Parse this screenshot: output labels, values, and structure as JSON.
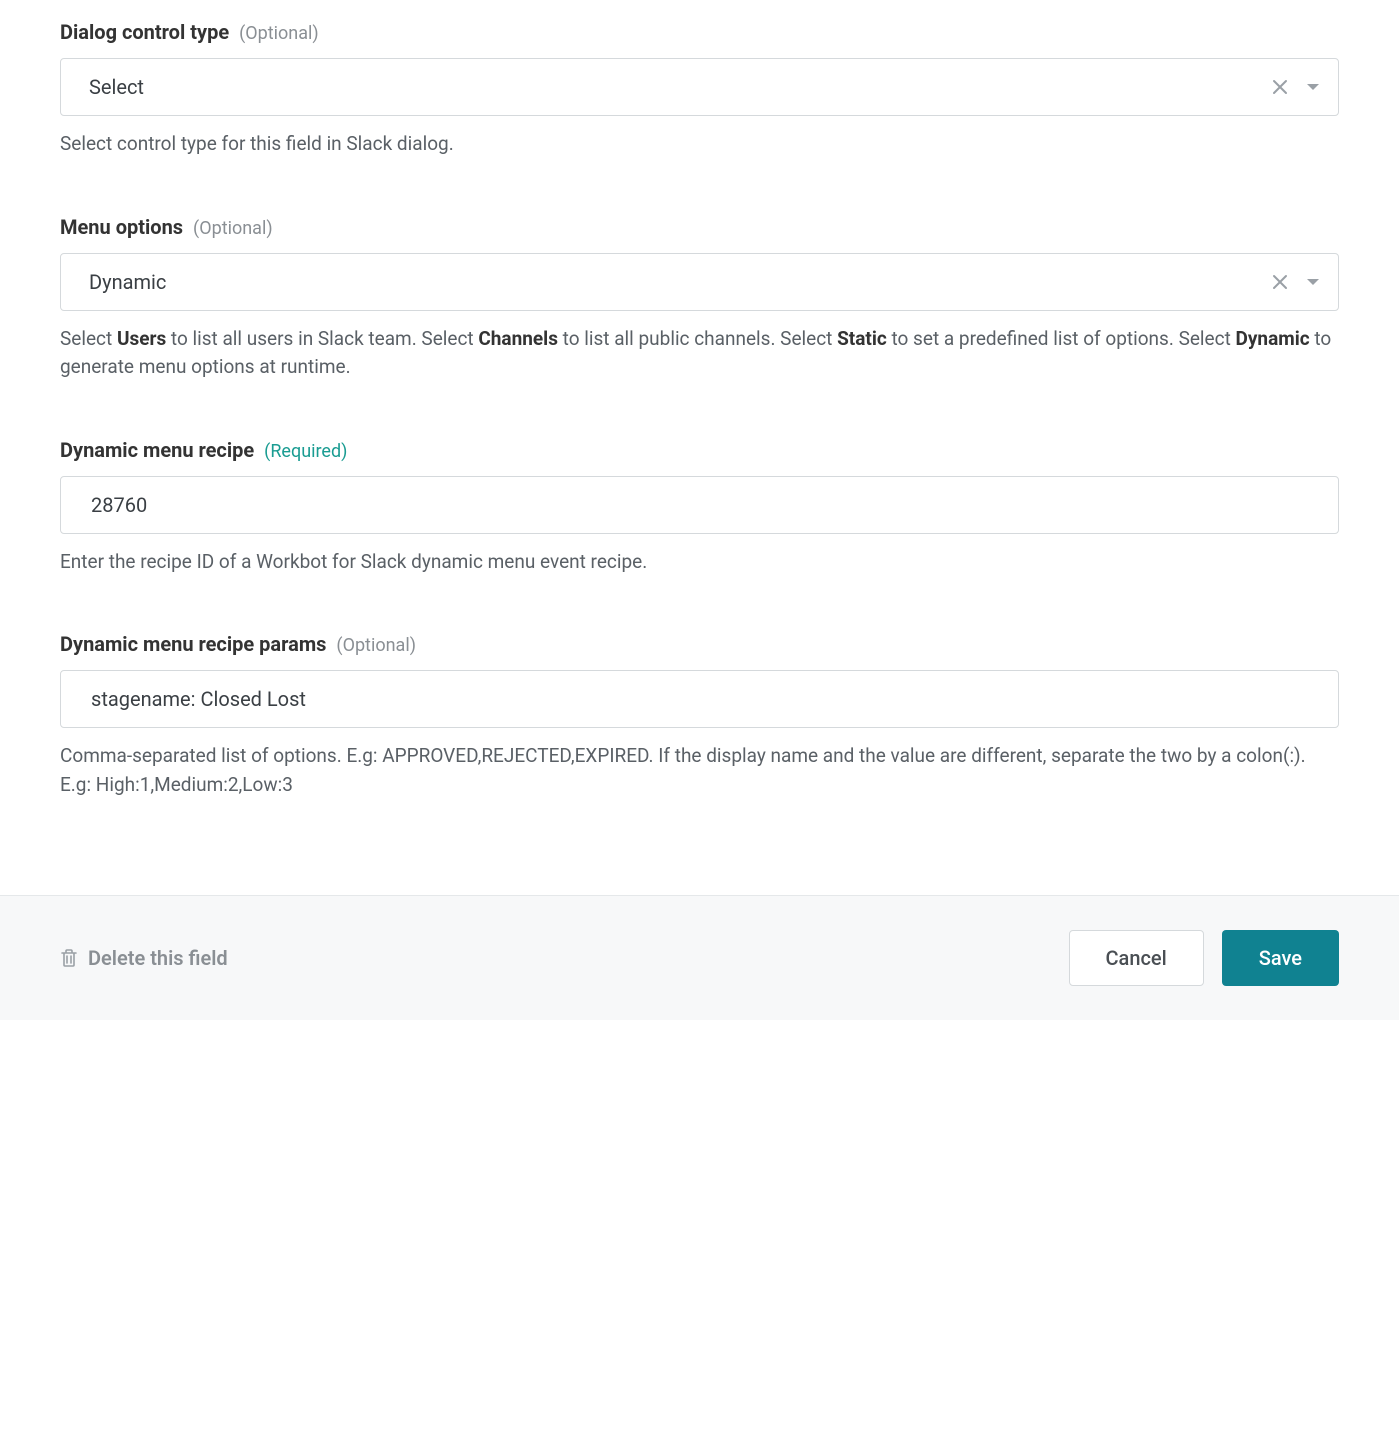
{
  "fields": {
    "dialog_control_type": {
      "label": "Dialog control type",
      "annotation": "(Optional)",
      "value": "Select",
      "hint": "Select control type for this field in Slack dialog."
    },
    "menu_options": {
      "label": "Menu options",
      "annotation": "(Optional)",
      "value": "Dynamic",
      "hint_parts": [
        "Select ",
        "Users",
        " to list all users in Slack team. Select ",
        "Channels",
        " to list all public channels. Select ",
        "Static",
        " to set a predefined list of options. Select ",
        "Dynamic",
        " to generate menu options at runtime."
      ]
    },
    "dynamic_menu_recipe": {
      "label": "Dynamic menu recipe",
      "annotation": "(Required)",
      "value": "28760",
      "hint": "Enter the recipe ID of a Workbot for Slack dynamic menu event recipe."
    },
    "dynamic_menu_recipe_params": {
      "label": "Dynamic menu recipe params",
      "annotation": "(Optional)",
      "value": "stagename: Closed Lost",
      "hint": "Comma-separated list of options. E.g: APPROVED,REJECTED,EXPIRED. If the display name and the value are different, separate the two by a colon(:). E.g: High:1,Medium:2,Low:3"
    }
  },
  "footer": {
    "delete_label": "Delete this field",
    "cancel_label": "Cancel",
    "save_label": "Save"
  }
}
